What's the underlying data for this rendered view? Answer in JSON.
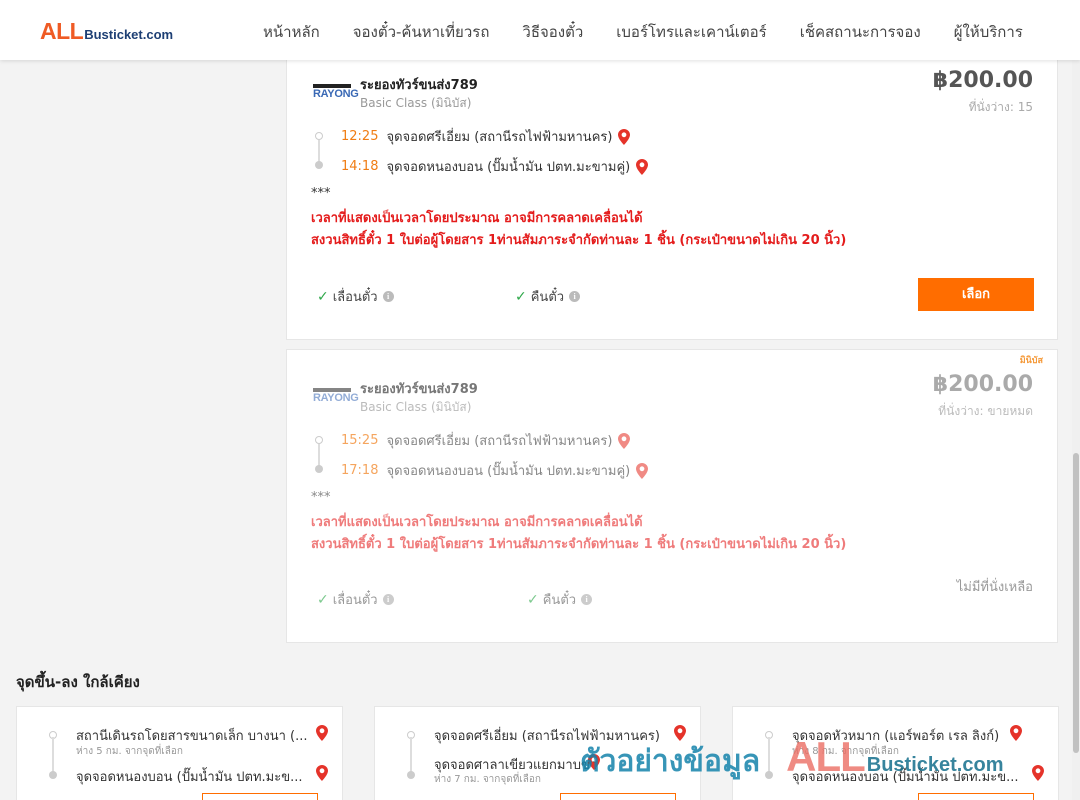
{
  "header": {
    "logo_all": "ALL",
    "logo_rest": "Busticket.com",
    "nav": [
      "หน้าหลัก",
      "จองตั๋ว-ค้นหาเที่ยวรถ",
      "วิธีจองตั๋ว",
      "เบอร์โทรและเคาน์เตอร์",
      "เช็คสถานะการจอง",
      "ผู้ให้บริการ"
    ]
  },
  "trips": [
    {
      "operator_logo": "RAYONG",
      "operator": "ระยองทัวร์ขนส่ง789",
      "bus_class": "Basic Class (มินิบัส)",
      "price": "฿200.00",
      "seats": "ที่นั่งว่าง: 15",
      "depart_time": "12:25",
      "depart_stop": "จุดจอดศรีเอี่ยม (สถานีรถไฟฟ้ามหานคร)",
      "arrive_time": "14:18",
      "arrive_stop": "จุดจอดหนองบอน (ปั๊มน้ำมัน ปตท.มะขามคู่)",
      "note": "***",
      "warning1": "เวลาที่แสดงเป็นเวลาโดยประมาณ อาจมีการคลาดเคลื่อนได้",
      "warning2": "สงวนสิทธิ์ตั๋ว 1 ใบต่อผู้โดยสาร 1ท่านสัมภาระจำกัดท่านละ 1 ชิ้น (กระเป๋าขนาดไม่เกิน 20 นิ้ว)",
      "feature1": "เลื่อนตั๋ว",
      "feature2": "คืนตั๋ว",
      "select_label": "เลือก"
    },
    {
      "badge": "มินิบัส",
      "operator_logo": "RAYONG",
      "operator": "ระยองทัวร์ขนส่ง789",
      "bus_class": "Basic Class (มินิบัส)",
      "price": "฿200.00",
      "seats": "ที่นั่งว่าง: ขายหมด",
      "depart_time": "15:25",
      "depart_stop": "จุดจอดศรีเอี่ยม (สถานีรถไฟฟ้ามหานคร)",
      "arrive_time": "17:18",
      "arrive_stop": "จุดจอดหนองบอน (ปั๊มน้ำมัน ปตท.มะขามคู่)",
      "note": "***",
      "warning1": "เวลาที่แสดงเป็นเวลาโดยประมาณ อาจมีการคลาดเคลื่อนได้",
      "warning2": "สงวนสิทธิ์ตั๋ว 1 ใบต่อผู้โดยสาร 1ท่านสัมภาระจำกัดท่านละ 1 ชิ้น (กระเป๋าขนาดไม่เกิน 20 นิ้ว)",
      "feature1": "เลื่อนตั๋ว",
      "feature2": "คืนตั๋ว",
      "no_seat": "ไม่มีที่นั่งเหลือ"
    }
  ],
  "nearby": {
    "title": "จุดขึ้น-ลง ใกล้เคียง",
    "cards": [
      {
        "from": "สถานีเดินรถโดยสารขนาดเล็ก บางนา (...",
        "from_dist": "ห่าง 5 กม. จากจุดที่เลือก",
        "to": "จุดจอดหนองบอน (ปั๊มน้ำมัน ปตท.มะข...",
        "to_dist": ""
      },
      {
        "from": "จุดจอดศรีเอี่ยม (สถานีรถไฟฟ้ามหานคร)",
        "from_dist": "",
        "to": "จุดจอดศาลาเขียวแยกมาบข่า",
        "to_dist": "ห่าง 7 กม. จากจุดที่เลือก"
      },
      {
        "from": "จุดจอดหัวหมาก (แอร์พอร์ต เรล ลิงก์)",
        "from_dist": "ห่าง 8 กม. จากจุดที่เลือก",
        "to": "จุดจอดหนองบอน (ปั๊มน้ำมัน ปตท.มะข...",
        "to_dist": ""
      }
    ]
  },
  "watermark": {
    "thai": "ตัวอย่างข้อมูล",
    "all": "ALL",
    "rest": "Busticket.com"
  },
  "colors": {
    "accent": "#ff6d00",
    "time": "#f07d14",
    "warning": "#e41c1c",
    "check": "#2ea84a",
    "pin": "#e5332a"
  },
  "icons": [
    "map-pin-icon",
    "check-icon",
    "info-icon"
  ]
}
